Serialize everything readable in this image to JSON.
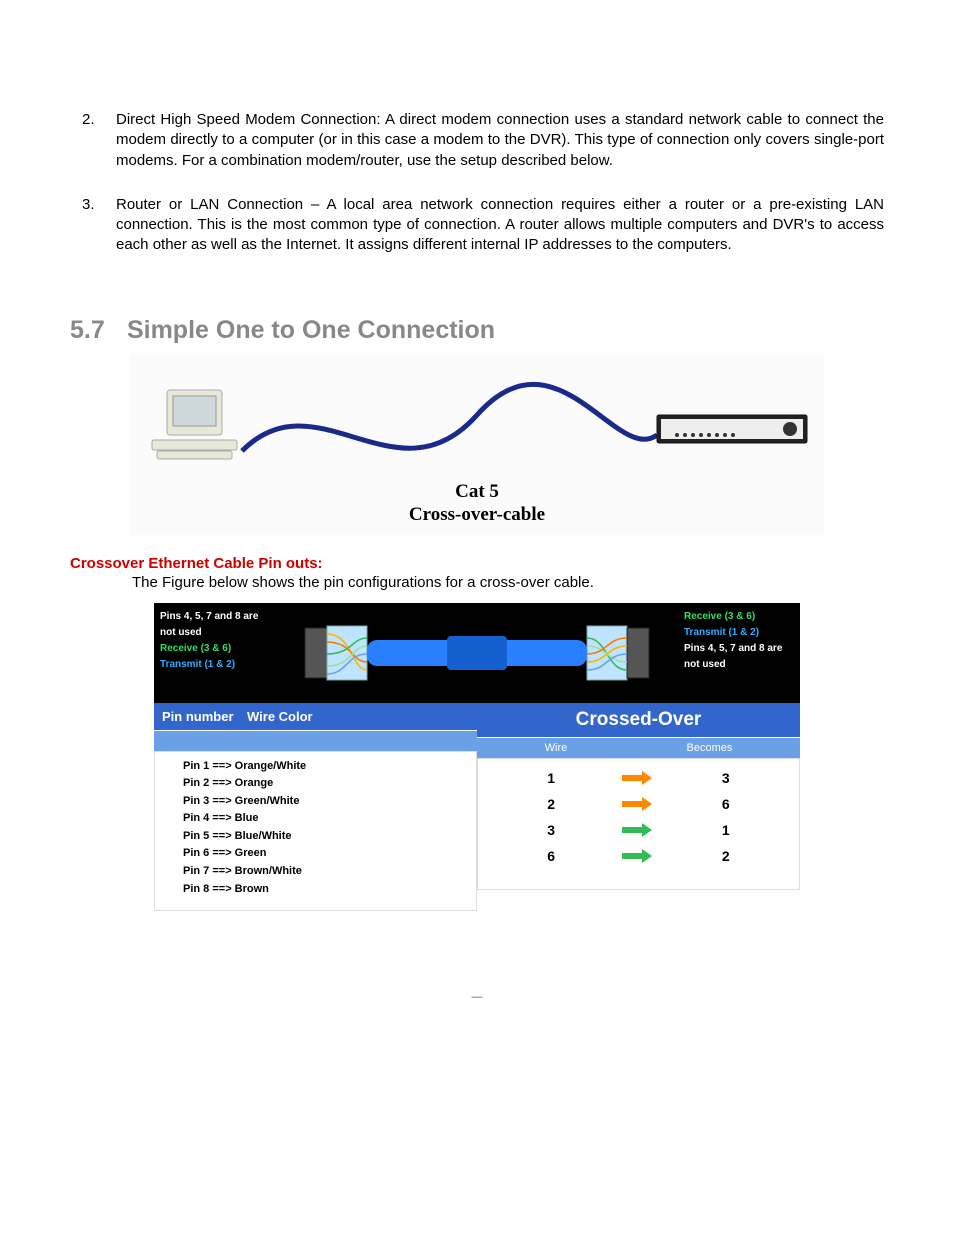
{
  "list": {
    "items": [
      {
        "num": "2.",
        "text": "Direct High Speed Modem Connection: A direct modem connection uses a standard network cable to connect the modem directly to a computer (or in this case a modem to the DVR). This type of connection only covers single-port modems. For a combination modem/router, use the setup described below."
      },
      {
        "num": "3.",
        "text": "Router or LAN Connection – A local area network connection requires either a router or a pre-existing LAN connection. This is the most common type of connection. A router allows multiple computers and DVR's to access each other as well as the Internet. It assigns different internal IP addresses to the computers."
      }
    ]
  },
  "section": {
    "number": "5.7",
    "title": "Simple One to One Connection"
  },
  "cable_caption": {
    "line1": "Cat 5",
    "line2": "Cross-over-cable"
  },
  "subheading": "Crossover Ethernet Cable Pin outs:",
  "fig_text": "The Figure below shows the pin configurations for a cross-over cable.",
  "top_strip": {
    "left": {
      "unused": "Pins 4, 5, 7 and 8 are not used",
      "receive": "Receive (3 & 6)",
      "transmit": "Transmit (1 & 2)"
    },
    "right": {
      "receive": "Receive (3 & 6)",
      "transmit": "Transmit (1 & 2)",
      "unused": "Pins 4, 5, 7 and 8 are not used"
    }
  },
  "pin_table": {
    "header_col1": "Pin number",
    "header_col2": "Wire Color",
    "rows": [
      "Pin 1 ==> Orange/White",
      "Pin 2 ==> Orange",
      "Pin 3 ==> Green/White",
      "Pin 4 ==> Blue",
      "Pin 5 ==> Blue/White",
      "Pin 6 ==> Green",
      "Pin 7 ==> Brown/White",
      "Pin 8 ==> Brown"
    ]
  },
  "cross_table": {
    "title": "Crossed-Over",
    "sub_col1": "Wire",
    "sub_col2": "Becomes",
    "rows": [
      {
        "a": "1",
        "b": "3",
        "color": "orange"
      },
      {
        "a": "2",
        "b": "6",
        "color": "orange"
      },
      {
        "a": "3",
        "b": "1",
        "color": "green"
      },
      {
        "a": "6",
        "b": "2",
        "color": "green"
      }
    ]
  },
  "footer": "—"
}
